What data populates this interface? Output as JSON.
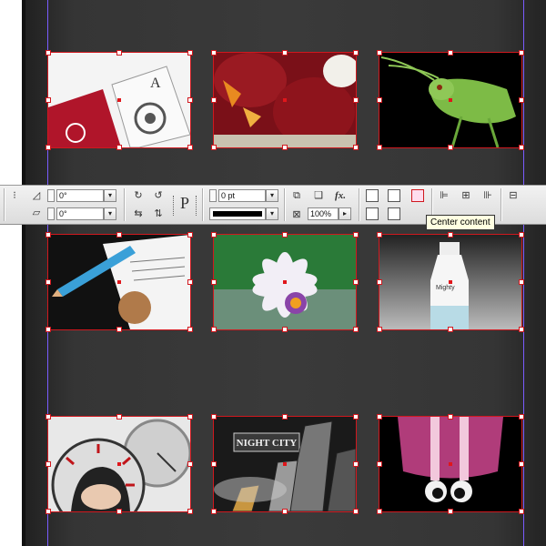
{
  "control_panel": {
    "rotation_angle": "0°",
    "shear_angle": "0°",
    "stroke_weight": "0 pt",
    "opacity": "100%",
    "text_frame_icon_label": "P",
    "effects_label": "fx."
  },
  "tooltip": {
    "text": "Center content"
  },
  "frames": [
    {
      "name": "playing-cards-image"
    },
    {
      "name": "red-fabric-image"
    },
    {
      "name": "grasshopper-image"
    },
    {
      "name": "pencil-documents-image"
    },
    {
      "name": "flower-image"
    },
    {
      "name": "bottle-image"
    },
    {
      "name": "clock-face-image"
    },
    {
      "name": "night-city-image",
      "caption": "NIGHT CITY"
    },
    {
      "name": "cartoon-eyes-image"
    }
  ],
  "colors": {
    "frame_outline": "#d0181e",
    "guide": "#7a5cff",
    "tooltip_bg": "#ffffe1"
  }
}
